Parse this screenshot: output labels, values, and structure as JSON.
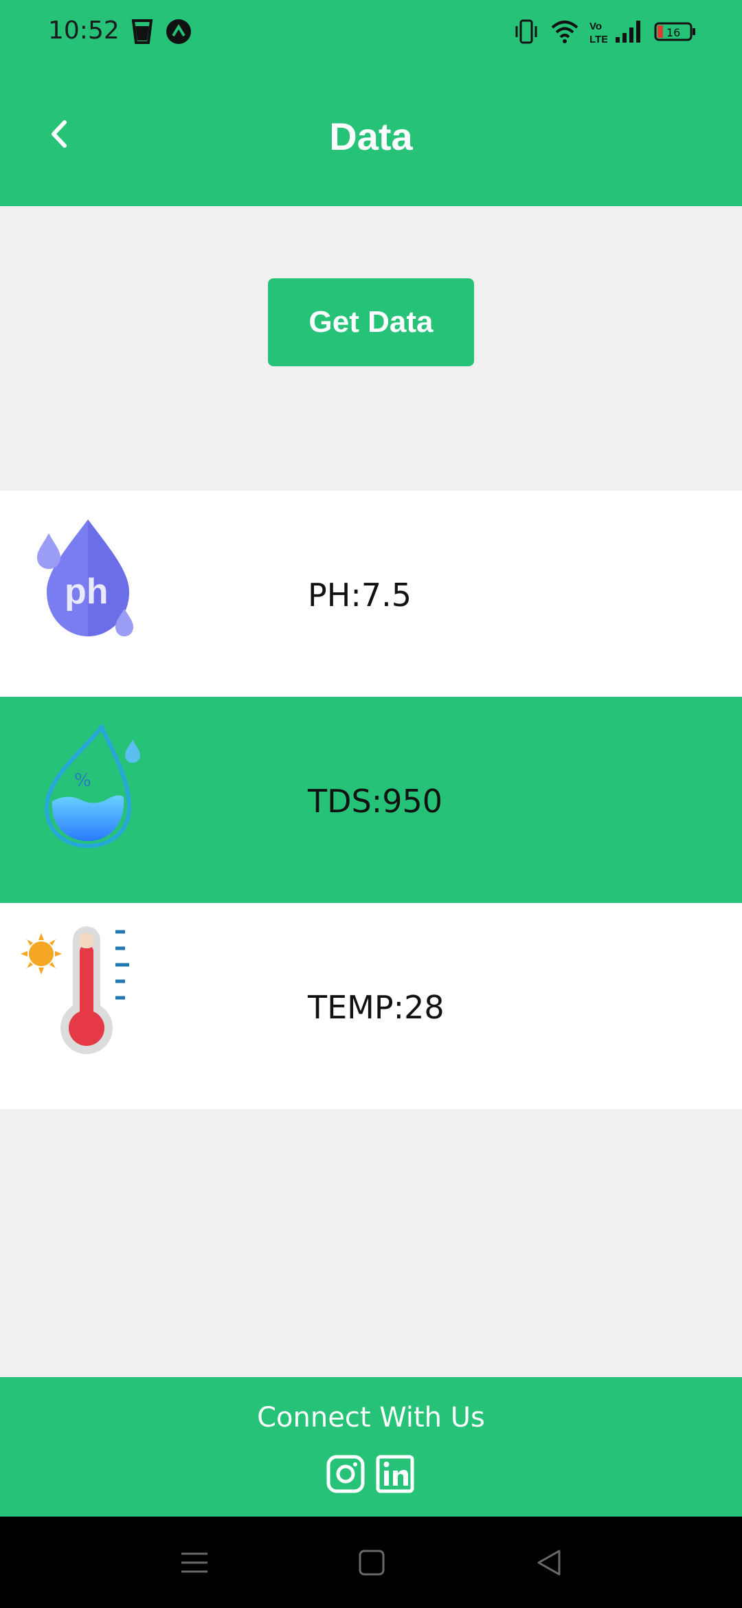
{
  "status_bar": {
    "time": "10:52",
    "battery": "16",
    "icons": [
      "cup-icon",
      "arrow-up-circle-icon",
      "vibrate-icon",
      "wifi-icon",
      "volte-icon",
      "signal-icon",
      "battery-icon"
    ]
  },
  "header": {
    "title": "Data",
    "back_icon": "chevron-left-icon"
  },
  "actions": {
    "get_data_label": "Get Data"
  },
  "readings": [
    {
      "icon": "ph-drop-icon",
      "label": "PH:7.5"
    },
    {
      "icon": "tds-water-drop-icon",
      "label": "TDS:950"
    },
    {
      "icon": "thermometer-sun-icon",
      "label": "TEMP:28"
    }
  ],
  "footer": {
    "connect_label": "Connect With Us",
    "social": [
      "instagram-icon",
      "linkedin-icon"
    ]
  },
  "nav": [
    "menu-icon",
    "home-square-icon",
    "back-triangle-icon"
  ],
  "colors": {
    "brand_green": "#25c277",
    "background": "#f0f0f0"
  }
}
